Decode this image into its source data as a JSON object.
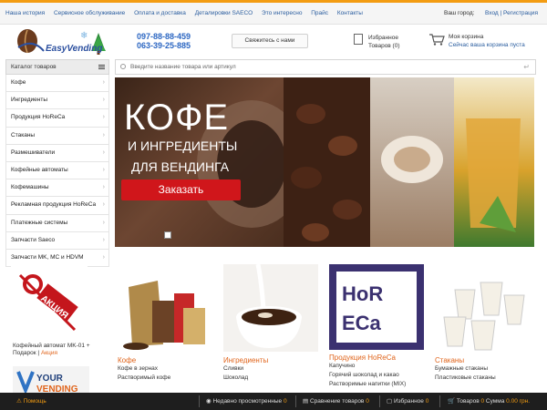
{
  "topnav": {
    "links": [
      "Наша история",
      "Сервисное обслуживание",
      "Оплата и доставка",
      "Детали­ровки SAECO",
      "Это интересно",
      "Прайс",
      "Контакты"
    ],
    "city_label": "Ваш город:",
    "login": "Вход",
    "register": "Регистрация"
  },
  "header": {
    "logo_text": "EasyVending",
    "phone1": "097-88-88-459",
    "phone2": "063-39-25-885",
    "contact_button": "Свяжитесь с нами",
    "favorites_label": "Избранное",
    "favorites_count": "Товаров (0)",
    "cart_label": "Моя корзина",
    "cart_status": "Сейчас ваша корзина пуста"
  },
  "catalog": {
    "title": "Каталог товаров",
    "items": [
      "Кофе",
      "Ингредиенты",
      "Продукция HoReCa",
      "Стаканы",
      "Размешиватели",
      "Кофейные автоматы",
      "Кофемашины",
      "Рекламная продукция HoReCa",
      "Платежные системы",
      "Запчасти Saeco",
      "Запчасти MK, MC и HDVM"
    ]
  },
  "search": {
    "placeholder": "Введите название товара или артикул"
  },
  "banner": {
    "title": "КОФЕ",
    "subtitle1": "И ИНГРЕДИЕНТЫ",
    "subtitle2": "ДЛЯ ВЕНДИНГА",
    "button": "Заказать"
  },
  "promo": {
    "badge": "АКЦИЯ",
    "text": "Кофейный автомат MK-01 + Подарок |",
    "tag": "Акция",
    "brand_line1": "YOUR",
    "brand_line2": "VENDING"
  },
  "products": [
    {
      "name": "Кофе",
      "subs": [
        "Кофе в зернах",
        "Растворимый кофе"
      ]
    },
    {
      "name": "Ингредиенты",
      "subs": [
        "Сливки",
        "Шоколад"
      ]
    },
    {
      "name": "Продукция HoReCa",
      "subs": [
        "Капучино",
        "Горячий шоколад и какао",
        "Растворимые напитки (MIX)"
      ],
      "logo": "HoRECa"
    },
    {
      "name": "Стаканы",
      "subs": [
        "Бумажные стаканы",
        "Пластиковые стаканы"
      ]
    }
  ],
  "bottombar": {
    "help": "Помощь",
    "recent": "Недавно просмотренные",
    "recent_count": "0",
    "compare": "Сравнение товаров",
    "compare_count": "0",
    "favorites": "Избранное",
    "favorites_count": "0",
    "goods": "Товаров",
    "goods_count": "0",
    "sum": "Сумма",
    "sum_value": "0.00 грн."
  },
  "colors": {
    "accent_orange": "#f39c12",
    "link_blue": "#2a5d9f",
    "order_red": "#d0161b",
    "bottombar": "#1e1e1e"
  }
}
